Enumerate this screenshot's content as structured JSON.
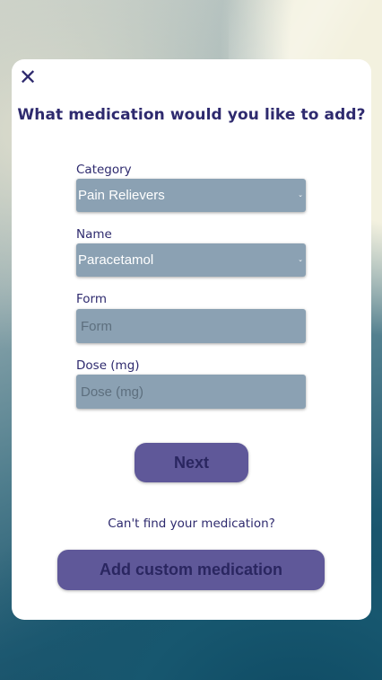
{
  "dialog": {
    "close_symbol": "✕",
    "title": "What medication would you like to add?"
  },
  "form": {
    "category": {
      "label": "Category",
      "value": "Pain Relievers"
    },
    "name": {
      "label": "Name",
      "value": "Paracetamol"
    },
    "form_field": {
      "label": "Form",
      "value": "",
      "placeholder": "Form"
    },
    "dose": {
      "label": "Dose (mg)",
      "value": "",
      "placeholder": "Dose (mg)"
    },
    "caret_symbol": "⌄"
  },
  "actions": {
    "next_label": "Next",
    "cant_find_text": "Can't find your medication?",
    "custom_label": "Add custom medication"
  },
  "colors": {
    "text_primary": "#2e2a6e",
    "field_bg": "#8ba1b3",
    "button_bg": "#5f5899",
    "card_bg": "#ffffff"
  },
  "icons": {
    "close": "close-icon",
    "dropdown": "chevron-down-icon"
  }
}
